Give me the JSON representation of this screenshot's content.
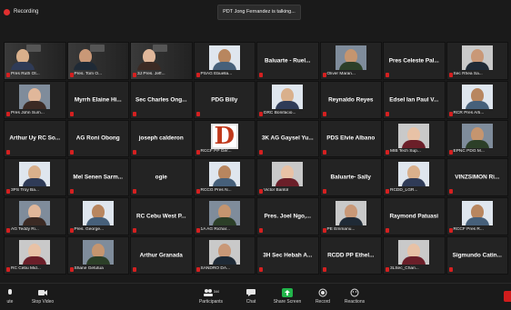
{
  "status": {
    "recording_label": "Recording"
  },
  "talking_banner": "PDT Jong Fernandez is talking...",
  "participants_count": "346",
  "toolbar": {
    "mute_label": "ute",
    "stop_video_label": "Stop Video",
    "participants_label": "Participants",
    "chat_label": "Chat",
    "share_label": "Share Screen",
    "record_label": "Record",
    "reactions_label": "Reactions"
  },
  "tiles": [
    {
      "kind": "collage",
      "label": "Pres Ruth Ot..."
    },
    {
      "kind": "collage",
      "label": "Pres. Tom O..."
    },
    {
      "kind": "collage",
      "label": "3J Pres. Jeff..."
    },
    {
      "kind": "photo",
      "label": "PSAG Ebuella..."
    },
    {
      "kind": "text",
      "label": "Baluarte - Ruel..."
    },
    {
      "kind": "photo",
      "label": "Oliver Maran..."
    },
    {
      "kind": "text",
      "label": "Pres Celeste Pal..."
    },
    {
      "kind": "photo",
      "label": "Sec Rhea Sa..."
    },
    {
      "kind": "photo",
      "label": "Pres John Sum..."
    },
    {
      "kind": "text",
      "label": "Myrrh Elaine Hi..."
    },
    {
      "kind": "text",
      "label": "Sec Charles Ong..."
    },
    {
      "kind": "text",
      "label": "PDG Billy"
    },
    {
      "kind": "photo",
      "label": "DRC Bonifacio..."
    },
    {
      "kind": "text",
      "label": "Reynaldo Reyes"
    },
    {
      "kind": "text",
      "label": "Edsel Ian Paul V..."
    },
    {
      "kind": "photo",
      "label": "RCR Pres Arti..."
    },
    {
      "kind": "text",
      "label": "Arthur Uy RC So..."
    },
    {
      "kind": "text",
      "label": "AG Roni Obong"
    },
    {
      "kind": "text",
      "label": "joseph calderon"
    },
    {
      "kind": "logo",
      "label": "RCCF PP Ger..."
    },
    {
      "kind": "text",
      "label": "3K AG Gaysel Yu..."
    },
    {
      "kind": "text",
      "label": "PDS Elvie Albano"
    },
    {
      "kind": "photo",
      "label": "MIB Tech Sup..."
    },
    {
      "kind": "photo",
      "label": "EPNC PDG M..."
    },
    {
      "kind": "photo",
      "label": "3PS Troy Ba..."
    },
    {
      "kind": "text",
      "label": "Mel Senen Sarm..."
    },
    {
      "kind": "text",
      "label": "ogie"
    },
    {
      "kind": "photo",
      "label": "RCCG Pres N..."
    },
    {
      "kind": "photo",
      "label": "Victor Bantol"
    },
    {
      "kind": "text",
      "label": "Baluarte- Sally"
    },
    {
      "kind": "photo",
      "label": "RCDD_LGR..."
    },
    {
      "kind": "text",
      "label": "VINZSIMON Ri..."
    },
    {
      "kind": "photo",
      "label": "AG Teddy Ri..."
    },
    {
      "kind": "photo",
      "label": "Pres. George..."
    },
    {
      "kind": "text",
      "label": "RC Cebu West P..."
    },
    {
      "kind": "photo",
      "label": "1A AG Richar..."
    },
    {
      "kind": "text",
      "label": "Pres. Joel Ngo,..."
    },
    {
      "kind": "photo",
      "label": "PE Emmanu..."
    },
    {
      "kind": "text",
      "label": "Raymond Patuasi"
    },
    {
      "kind": "photo",
      "label": "RCCF Pres R..."
    },
    {
      "kind": "photo",
      "label": "RC Cebu Mid..."
    },
    {
      "kind": "photo",
      "label": "Shane Getutua"
    },
    {
      "kind": "text",
      "label": "Arthur Granada"
    },
    {
      "kind": "photo",
      "label": "SANDRO DA..."
    },
    {
      "kind": "text",
      "label": "3H Sec Hebah A..."
    },
    {
      "kind": "text",
      "label": "RCDD PP Ethel..."
    },
    {
      "kind": "photo",
      "label": "3LSec_Chari..."
    },
    {
      "kind": "text",
      "label": "Sigmundo Catin..."
    }
  ],
  "tile_kinds": [
    "photo",
    "text",
    "logo",
    "collage"
  ],
  "colors": {
    "background": "#1a1a1a",
    "tile": "#232323",
    "mic_muted": "#d42020",
    "share_green": "#21b44a",
    "end_red": "#d11c1c"
  },
  "icons": [
    "mic-muted-icon",
    "video-icon",
    "participants-icon",
    "chat-icon",
    "share-screen-icon",
    "record-icon",
    "reactions-icon"
  ]
}
